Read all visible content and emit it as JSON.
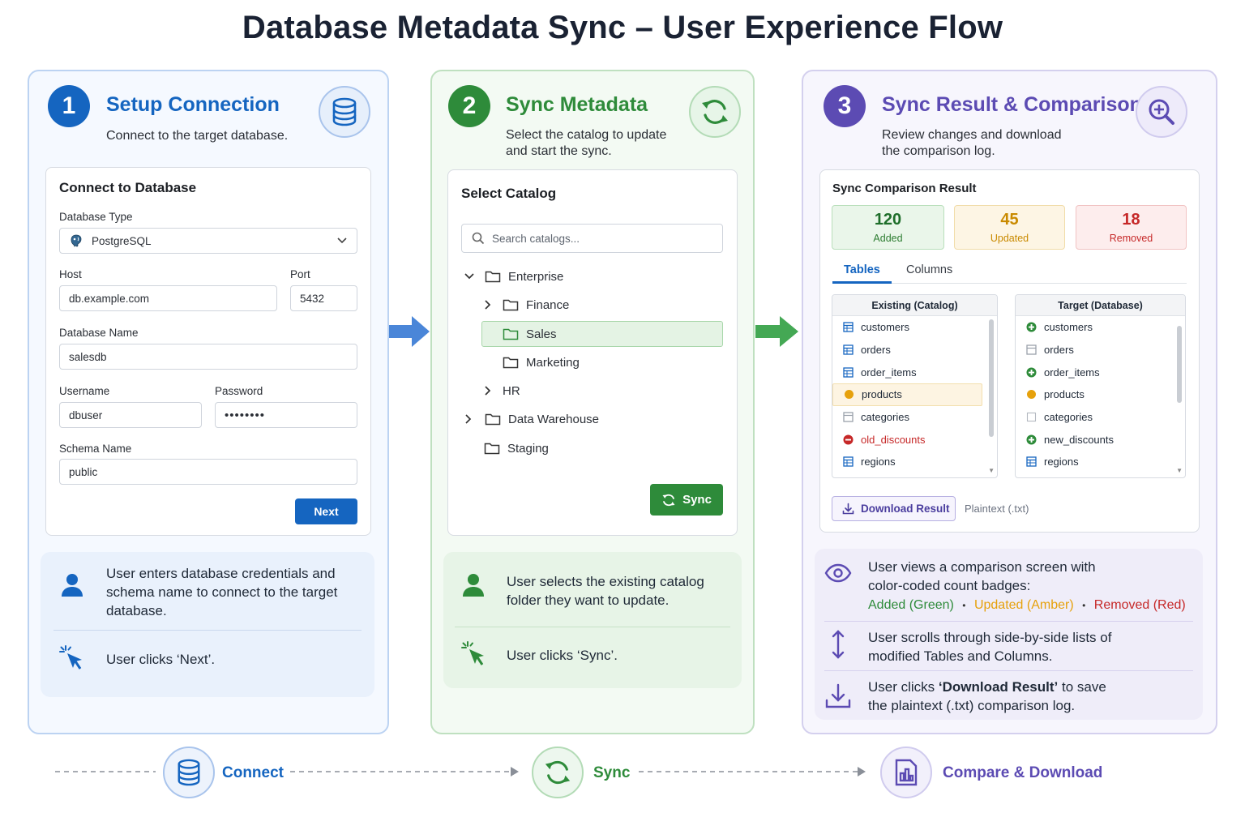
{
  "title": "Database Metadata Sync – User Experience Flow",
  "colors": {
    "blue": "#1565c0",
    "green": "#2e8b3a",
    "purple": "#5c4bb3",
    "amber": "#d99a00",
    "red": "#c62828"
  },
  "step1": {
    "number": "1",
    "heading": "Setup Connection",
    "desc": "Connect to the target database.",
    "icon": "database-icon",
    "card": {
      "title": "Connect to Database",
      "db_type_label": "Database Type",
      "db_type_value": "PostgreSQL",
      "host_label": "Host",
      "host_value": "db.example.com",
      "port_label": "Port",
      "port_value": "5432",
      "dbname_label": "Database Name",
      "dbname_value": "salesdb",
      "username_label": "Username",
      "username_value": "dbuser",
      "password_label": "Password",
      "password_value": "••••••••",
      "schema_label": "Schema Name",
      "schema_value": "public",
      "next_label": "Next"
    },
    "note1": "User enters database credentials and schema name to connect to the target database.",
    "note2_prefix": "User clicks ",
    "note2_em": "‘Next’",
    "note2_suffix": "."
  },
  "step2": {
    "number": "2",
    "heading": "Sync Metadata",
    "desc": "Select the catalog to update and start the sync.",
    "icon": "sync-icon",
    "card": {
      "title": "Select Catalog",
      "search_placeholder": "Search catalogs...",
      "tree": [
        "Enterprise",
        "Finance",
        "Sales",
        "Marketing",
        "HR",
        "Data Warehouse",
        "Staging"
      ],
      "sync_label": "Sync"
    },
    "note1": "User selects the existing catalog folder they want to update.",
    "note2_prefix": "User clicks ",
    "note2_em": "‘Sync’",
    "note2_suffix": "."
  },
  "step3": {
    "number": "3",
    "heading": "Sync Result & Comparison",
    "desc": "Review changes and download the comparison log.",
    "icon": "magnify-plus-icon",
    "card": {
      "title": "Sync Comparison Result",
      "badges": [
        {
          "num": "120",
          "cap": "Added"
        },
        {
          "num": "45",
          "cap": "Updated"
        },
        {
          "num": "18",
          "cap": "Removed"
        }
      ],
      "tabs": [
        "Tables",
        "Columns"
      ],
      "existing_header": "Existing (Catalog)",
      "target_header": "Target (Database)",
      "existing_items": [
        "customers",
        "orders",
        "order_items",
        "products",
        "categories",
        "old_discounts",
        "regions"
      ],
      "target_items": [
        "customers",
        "orders",
        "order_items",
        "products",
        "categories",
        "new_discounts",
        "regions"
      ],
      "download_label": "Download Result",
      "format_label": "Plaintext (.txt)"
    },
    "note1_line1": "User views a comparison screen with color-coded count badges:",
    "legend_added": "Added (Green)",
    "legend_updated": "Updated (Amber)",
    "legend_removed": "Removed (Red)",
    "legend_sep": "•",
    "note2": "User scrolls through side-by-side lists of modified Tables and Columns.",
    "note3_prefix": "User clicks ",
    "note3_em": "‘Download Result’",
    "note3_suffix": " to save the plaintext (.txt) comparison log."
  },
  "flow": {
    "connect": "Connect",
    "sync": "Sync",
    "compare": "Compare & Download"
  }
}
